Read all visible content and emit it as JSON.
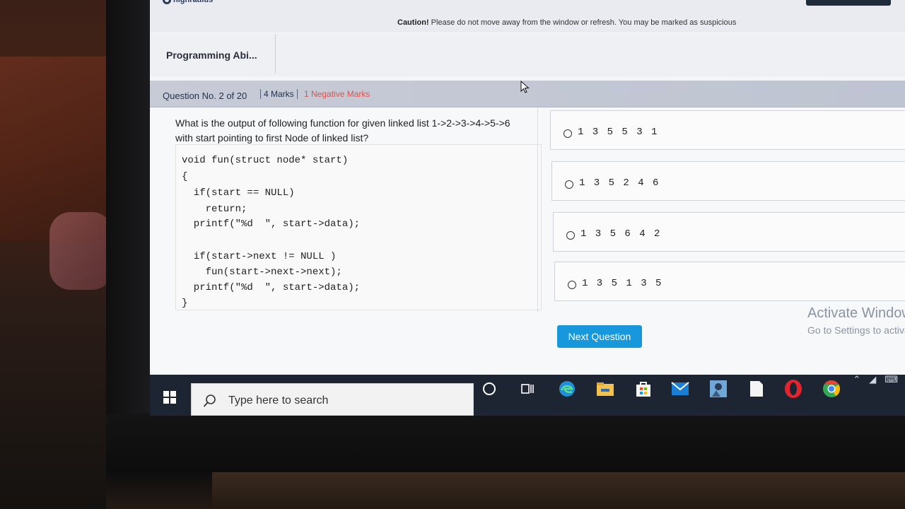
{
  "header": {
    "logo_text": "highradius",
    "caution_label": "Caution!",
    "caution_text": "Please do not move away from the window or refresh. You may be marked as suspicious"
  },
  "section": {
    "title": "Programming Abi..."
  },
  "question_bar": {
    "number": "Question No. 2 of 20",
    "marks": "4 Marks",
    "negative": "1 Negative Marks"
  },
  "question": {
    "text": "What is the output of following function for given linked list 1->2->3->4->5->6 with start pointing to first Node of linked list?",
    "code": [
      "void fun(struct node* start)",
      "{",
      "  if(start == NULL)",
      "    return;",
      "  printf(\"%d  \", start->data);",
      "",
      "  if(start->next != NULL )",
      "    fun(start->next->next);",
      "  printf(\"%d  \", start->data);",
      "}"
    ]
  },
  "options": [
    {
      "label": "1 3 5 5 3 1"
    },
    {
      "label": "1 3 5 2 4 6"
    },
    {
      "label": "1 3 5 6 4 2"
    },
    {
      "label": "1 3 5 1 3 5"
    }
  ],
  "actions": {
    "next_label": "Next Question"
  },
  "watermark": {
    "line1": "Activate Windows",
    "line2": "Go to Settings to activate Windows."
  },
  "taskbar": {
    "search_placeholder": "Type here to search",
    "icons": [
      "cortana-icon",
      "task-view-icon",
      "edge-icon",
      "file-explorer-icon",
      "store-icon",
      "mail-icon",
      "photos-icon",
      "notepad-icon",
      "opera-icon",
      "chrome-icon"
    ]
  },
  "colors": {
    "accent": "#1798dd",
    "negative": "#e0504d",
    "taskbar": "#1d2533"
  }
}
